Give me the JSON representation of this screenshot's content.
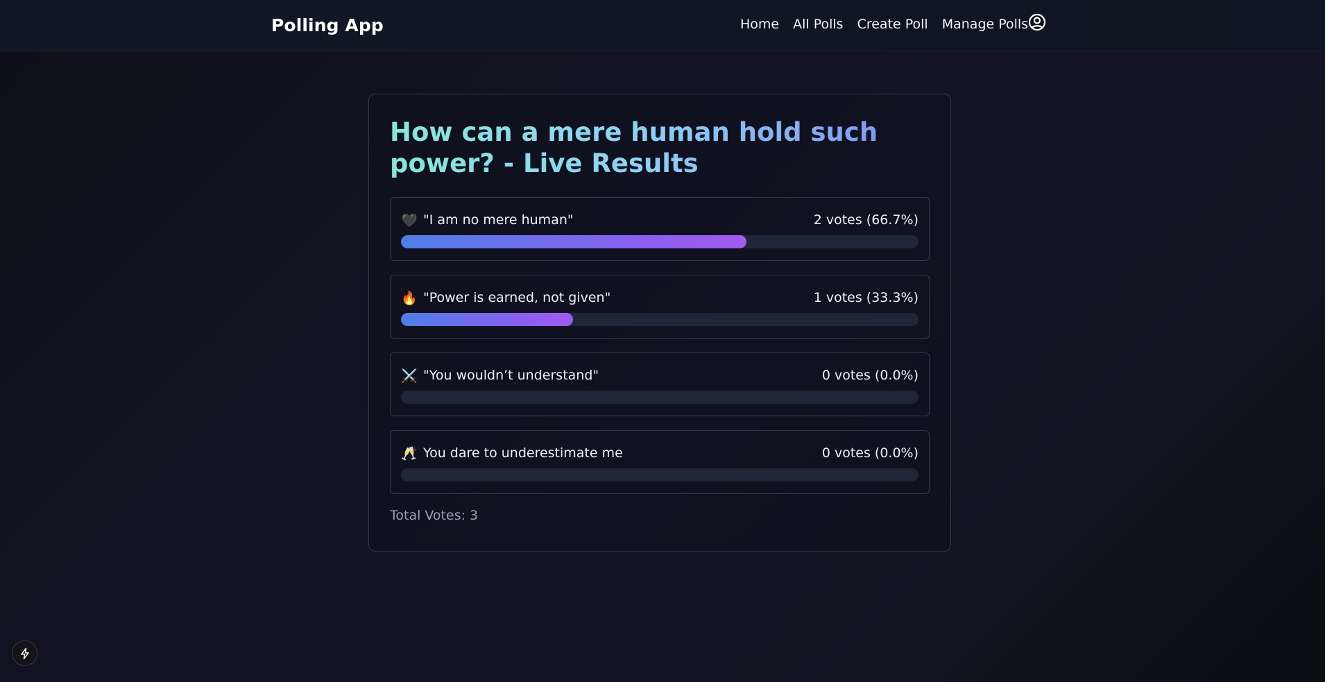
{
  "header": {
    "brand": "Polling App",
    "nav": [
      {
        "label": "Home"
      },
      {
        "label": "All Polls"
      },
      {
        "label": "Create Poll"
      },
      {
        "label": "Manage Polls"
      }
    ],
    "profile_icon": "user-circle-icon"
  },
  "poll": {
    "title": "How can a mere human hold such power? - Live Results",
    "options": [
      {
        "emoji": "🖤",
        "label": "\"I am no mere human\"",
        "votes_text": "2 votes (66.7%)",
        "percent": 66.7
      },
      {
        "emoji": "🔥",
        "label": "\"Power is earned, not given\"",
        "votes_text": "1 votes (33.3%)",
        "percent": 33.3
      },
      {
        "emoji": "⚔️",
        "label": "\"You wouldn’t understand\"",
        "votes_text": "0 votes (0.0%)",
        "percent": 0
      },
      {
        "emoji": "🥂",
        "label": "You dare to underestimate me",
        "votes_text": "0 votes (0.0%)",
        "percent": 0
      }
    ],
    "total": "Total Votes: 3"
  },
  "colors": {
    "bar_start": "#4f7fe8",
    "bar_end": "#a35af0",
    "title_start": "#86e7d8",
    "title_end": "#7f8ef0"
  },
  "dev_badge_icon": "bolt-icon"
}
